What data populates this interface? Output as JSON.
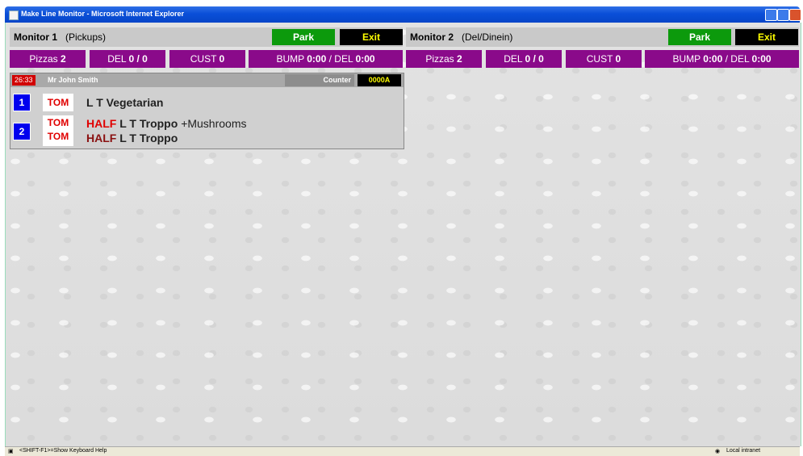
{
  "window": {
    "title": "Make Line Monitor - Microsoft Internet Explorer"
  },
  "monitor1": {
    "name": "Monitor 1",
    "mode": "(Pickups)",
    "park_label": "Park",
    "exit_label": "Exit",
    "stats": {
      "pizzas_label": "Pizzas",
      "pizzas_value": "2",
      "del_label": "DEL",
      "del_value": "0 / 0",
      "cust_label": "CUST",
      "cust_value": "0",
      "bump_label": "BUMP",
      "bump_value": "0:00",
      "bump_del_label": "/ DEL",
      "bump_del_value": "0:00"
    }
  },
  "monitor2": {
    "name": "Monitor 2",
    "mode": "(Del/Dinein)",
    "park_label": "Park",
    "exit_label": "Exit",
    "stats": {
      "pizzas_label": "Pizzas",
      "pizzas_value": "2",
      "del_label": "DEL",
      "del_value": "0 / 0",
      "cust_label": "CUST",
      "cust_value": "0",
      "bump_label": "BUMP",
      "bump_value": "0:00",
      "bump_del_label": "/ DEL",
      "bump_del_value": "0:00"
    }
  },
  "order": {
    "timer": "26:33",
    "customer": "Mr John Smith",
    "source": "Counter",
    "order_no": "0000A",
    "items": [
      {
        "num": "1",
        "lines": [
          {
            "sauce": "TOM",
            "half": "",
            "name": "L T Vegetarian",
            "mod": ""
          }
        ]
      },
      {
        "num": "2",
        "lines": [
          {
            "sauce": "TOM",
            "half": "HALF",
            "name": "L T Troppo",
            "mod": "+Mushrooms"
          },
          {
            "sauce": "TOM",
            "half": "HALF",
            "name": "L T Troppo",
            "mod": ""
          }
        ]
      }
    ]
  },
  "statusbar": {
    "left": "<SHIFT-F1>=Show Keyboard Help",
    "right": "Local intranet"
  },
  "colors": {
    "park": "#0c9a0c",
    "exit": "#000000",
    "stat_bar": "#8a0a8a",
    "item_number": "#0000ee",
    "half": "#e00000"
  }
}
